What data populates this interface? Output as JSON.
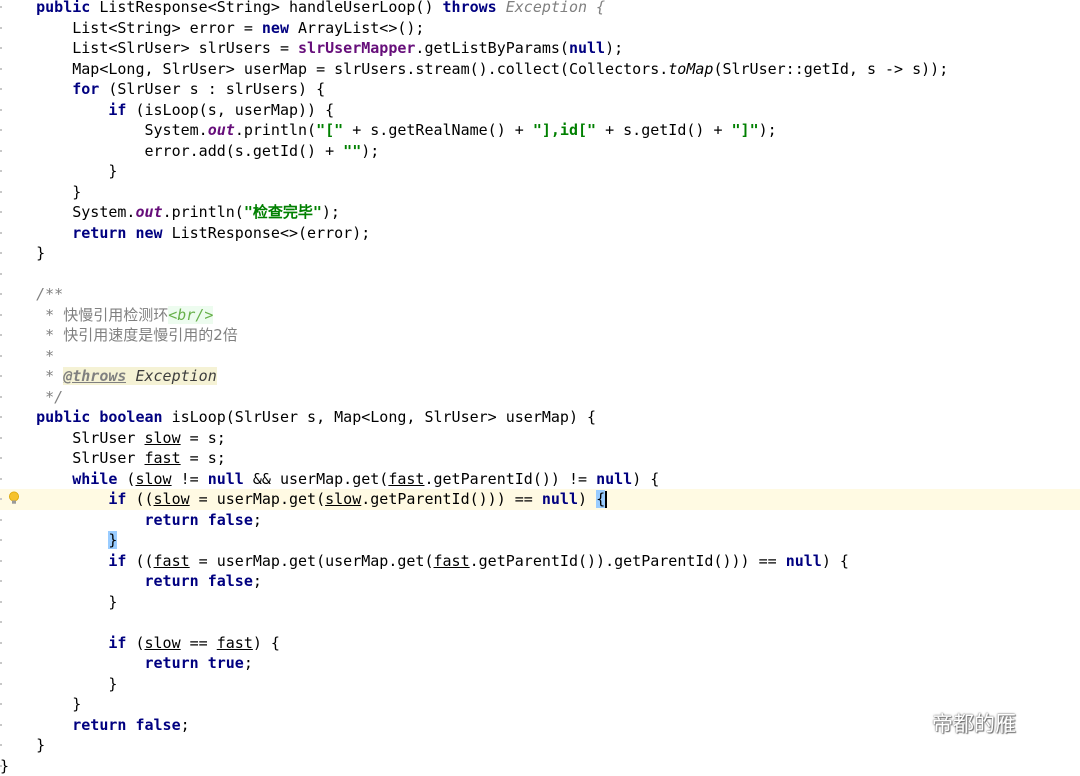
{
  "editor": {
    "lines": [
      [
        {
          "t": "    "
        },
        {
          "t": "public",
          "c": "kw"
        },
        {
          "t": " ListResponse<String> handleUserLoop() "
        },
        {
          "t": "throws",
          "c": "kw"
        },
        {
          "t": " Exception {",
          "c": "cmt"
        }
      ],
      [
        {
          "t": "        List<String> error = "
        },
        {
          "t": "new",
          "c": "kw"
        },
        {
          "t": " ArrayList<>();"
        }
      ],
      [
        {
          "t": "        List<SlrUser> slrUsers = "
        },
        {
          "t": "slrUserMapper",
          "c": "inst"
        },
        {
          "t": ".getListByParams("
        },
        {
          "t": "null",
          "c": "kw"
        },
        {
          "t": ");"
        }
      ],
      [
        {
          "t": "        Map<Long, SlrUser> userMap = slrUsers.stream().collect(Collectors."
        },
        {
          "t": "toMap",
          "c": "it"
        },
        {
          "t": "(SlrUser::getId, s -> s));"
        }
      ],
      [
        {
          "t": "        "
        },
        {
          "t": "for",
          "c": "kw"
        },
        {
          "t": " (SlrUser s : slrUsers) {"
        }
      ],
      [
        {
          "t": "            "
        },
        {
          "t": "if",
          "c": "kw"
        },
        {
          "t": " (isLoop(s, userMap)) {"
        }
      ],
      [
        {
          "t": "                System."
        },
        {
          "t": "out",
          "c": "fld"
        },
        {
          "t": ".println("
        },
        {
          "t": "\"[\"",
          "c": "str"
        },
        {
          "t": " + s.getRealName() + "
        },
        {
          "t": "\"],id[\"",
          "c": "str"
        },
        {
          "t": " + s.getId() + "
        },
        {
          "t": "\"]\"",
          "c": "str"
        },
        {
          "t": ");"
        }
      ],
      [
        {
          "t": "                error.add(s.getId() + "
        },
        {
          "t": "\"\"",
          "c": "str"
        },
        {
          "t": ");"
        }
      ],
      [
        {
          "t": "            }"
        }
      ],
      [
        {
          "t": "        }"
        }
      ],
      [
        {
          "t": "        System."
        },
        {
          "t": "out",
          "c": "fld"
        },
        {
          "t": ".println("
        },
        {
          "t": "\"检查完毕\"",
          "c": "str"
        },
        {
          "t": ");"
        }
      ],
      [
        {
          "t": "        "
        },
        {
          "t": "return",
          "c": "kw"
        },
        {
          "t": " "
        },
        {
          "t": "new",
          "c": "kw"
        },
        {
          "t": " ListResponse<>(error);"
        }
      ],
      [
        {
          "t": "    }"
        }
      ],
      [],
      [
        {
          "t": "    /**",
          "c": "cmt"
        }
      ],
      [
        {
          "t": "     * ",
          "c": "cmt"
        },
        {
          "t": "快慢引用检测环",
          "c": "cmt cjk"
        },
        {
          "t": "<br/>",
          "c": "html"
        }
      ],
      [
        {
          "t": "     * ",
          "c": "cmt"
        },
        {
          "t": "快引用速度是慢引用的2倍",
          "c": "cmt cjk"
        }
      ],
      [
        {
          "t": "     *",
          "c": "cmt"
        }
      ],
      [
        {
          "t": "     * ",
          "c": "cmt"
        },
        {
          "t": "@throws",
          "c": "doctag"
        },
        {
          "t": " ",
          "c": "docref"
        },
        {
          "t": "Exception",
          "c": "docref"
        }
      ],
      [
        {
          "t": "     */",
          "c": "cmt"
        }
      ],
      [
        {
          "t": "    "
        },
        {
          "t": "public",
          "c": "kw"
        },
        {
          "t": " "
        },
        {
          "t": "boolean",
          "c": "kw"
        },
        {
          "t": " isLoop(SlrUser s, Map<Long, SlrUser> userMap) {"
        }
      ],
      [
        {
          "t": "        SlrUser "
        },
        {
          "t": "slow",
          "c": "var"
        },
        {
          "t": " = s;"
        }
      ],
      [
        {
          "t": "        SlrUser "
        },
        {
          "t": "fast",
          "c": "var"
        },
        {
          "t": " = s;"
        }
      ],
      [
        {
          "t": "        "
        },
        {
          "t": "while",
          "c": "kw"
        },
        {
          "t": " ("
        },
        {
          "t": "slow",
          "c": "var"
        },
        {
          "t": " != "
        },
        {
          "t": "null",
          "c": "kw"
        },
        {
          "t": " && userMap.get("
        },
        {
          "t": "fast",
          "c": "var"
        },
        {
          "t": ".getParentId()) != "
        },
        {
          "t": "null",
          "c": "kw"
        },
        {
          "t": ") {"
        }
      ],
      [
        {
          "t": "            "
        },
        {
          "t": "if",
          "c": "kw"
        },
        {
          "t": " (("
        },
        {
          "t": "slow",
          "c": "var"
        },
        {
          "t": " = userMap.get("
        },
        {
          "t": "slow",
          "c": "var"
        },
        {
          "t": ".getParentId())) == "
        },
        {
          "t": "null",
          "c": "kw"
        },
        {
          "t": ") "
        },
        {
          "t": "{",
          "c": "brace-hl"
        },
        {
          "t": "",
          "c": "caret"
        }
      ],
      [
        {
          "t": "                "
        },
        {
          "t": "return",
          "c": "kw"
        },
        {
          "t": " "
        },
        {
          "t": "false",
          "c": "kw"
        },
        {
          "t": ";"
        }
      ],
      [
        {
          "t": "            "
        },
        {
          "t": "}",
          "c": "brace-hl"
        }
      ],
      [
        {
          "t": "            "
        },
        {
          "t": "if",
          "c": "kw"
        },
        {
          "t": " (("
        },
        {
          "t": "fast",
          "c": "var"
        },
        {
          "t": " = userMap.get(userMap.get("
        },
        {
          "t": "fast",
          "c": "var"
        },
        {
          "t": ".getParentId()).getParentId())) == "
        },
        {
          "t": "null",
          "c": "kw"
        },
        {
          "t": ") {"
        }
      ],
      [
        {
          "t": "                "
        },
        {
          "t": "return",
          "c": "kw"
        },
        {
          "t": " "
        },
        {
          "t": "false",
          "c": "kw"
        },
        {
          "t": ";"
        }
      ],
      [
        {
          "t": "            }"
        }
      ],
      [],
      [
        {
          "t": "            "
        },
        {
          "t": "if",
          "c": "kw"
        },
        {
          "t": " ("
        },
        {
          "t": "slow",
          "c": "var"
        },
        {
          "t": " == "
        },
        {
          "t": "fast",
          "c": "var"
        },
        {
          "t": ") {"
        }
      ],
      [
        {
          "t": "                "
        },
        {
          "t": "return",
          "c": "kw"
        },
        {
          "t": " "
        },
        {
          "t": "true",
          "c": "kw"
        },
        {
          "t": ";"
        }
      ],
      [
        {
          "t": "            }"
        }
      ],
      [
        {
          "t": "        }"
        }
      ],
      [
        {
          "t": "        "
        },
        {
          "t": "return",
          "c": "kw"
        },
        {
          "t": " "
        },
        {
          "t": "false",
          "c": "kw"
        },
        {
          "t": ";"
        }
      ],
      [
        {
          "t": "    }"
        }
      ],
      [
        {
          "t": "}"
        }
      ]
    ],
    "current_line": 24,
    "intention_icon": "lightbulb-icon"
  },
  "watermark": {
    "icon": "wechat-icon",
    "text": "帝都的雁"
  },
  "colors": {
    "keyword": "#000080",
    "string": "#008000",
    "field": "#660e7a",
    "comment": "#808080",
    "current_line": "#fffae3",
    "brace_match": "#99ccff"
  }
}
